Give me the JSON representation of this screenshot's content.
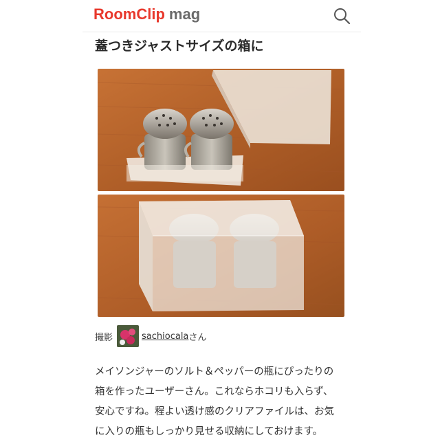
{
  "header": {
    "logo_text_main": "RoomClip",
    "logo_text_sub": "mag",
    "search_icon": "search-icon"
  },
  "article": {
    "title": "蓋つきジャストサイズの箱に",
    "images": [
      {
        "description_icon": "photo-image",
        "alt": ""
      },
      {
        "description_icon": "photo-image",
        "alt": ""
      }
    ],
    "credit": {
      "label": "撮影",
      "author": "sachiocala",
      "suffix": "さん"
    },
    "body_lines": [
      "メイソンジャーのソルト＆ペッパーの瓶にぴったりの",
      "箱を作ったユーザーさん。これならホコリも入らず、",
      "安心ですね。程よい透け感のクリアファイルは、お気",
      "に入りの瓶もしっかり見せる収納にしておけます。"
    ]
  },
  "colors": {
    "brand_red": "#e8382c",
    "text": "#333333",
    "wood": "#b8642e"
  }
}
